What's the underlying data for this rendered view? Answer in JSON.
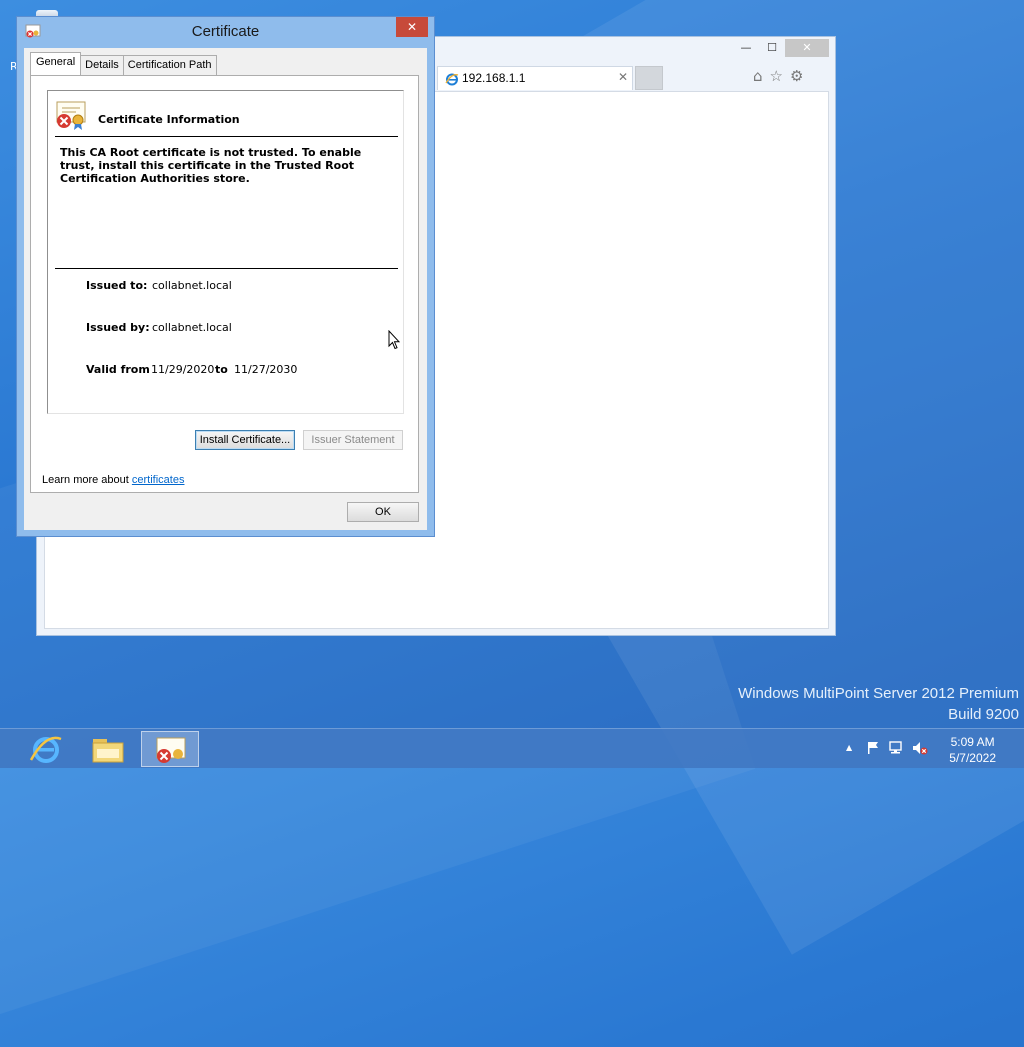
{
  "desktop": {
    "recycle_label": "R",
    "os_name": "Windows MultiPoint Server 2012 Premium",
    "os_build": "Build 9200"
  },
  "browser": {
    "tab_title": "192.168.1.1",
    "tab_close": "✕",
    "minimize": "—",
    "maximize": "☐",
    "close": "✕",
    "home_icon": "⌂",
    "favorites_icon": "☆",
    "settings_icon": "⚙"
  },
  "dialog": {
    "title": "Certificate",
    "close": "✕",
    "tabs": [
      "General",
      "Details",
      "Certification Path"
    ],
    "active_tab": "General",
    "info_title": "Certificate Information",
    "message": "This CA Root certificate is not trusted. To enable trust, install this certificate in the Trusted Root Certification Authorities store.",
    "issued_to_label": "Issued to:",
    "issued_to": "collabnet.local",
    "issued_by_label": "Issued by:",
    "issued_by": "collabnet.local",
    "valid_from_label": "Valid from",
    "valid_from": "11/29/2020",
    "to_label": "to",
    "valid_to": "11/27/2030",
    "install_button": "Install Certificate...",
    "issuer_button": "Issuer Statement",
    "learn_prefix": "Learn more about ",
    "learn_link": "certificates",
    "ok_button": "OK"
  },
  "taskbar": {
    "items": [
      "internet-explorer",
      "file-explorer",
      "certificate"
    ],
    "tray_expand": "▲",
    "time": "5:09 AM",
    "date": "5/7/2022"
  },
  "colors": {
    "accent": "#8fbcec",
    "close_red": "#c74a3a",
    "link": "#0066cc"
  }
}
